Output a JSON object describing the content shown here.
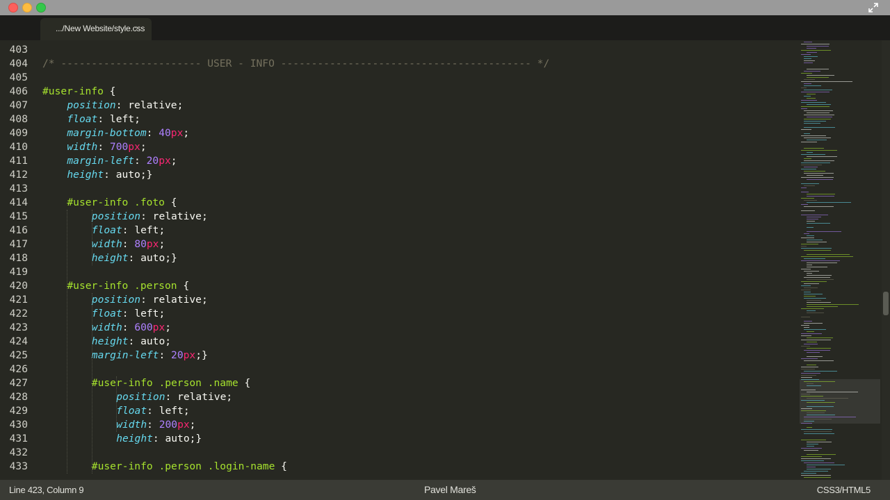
{
  "tab": {
    "label": ".../New Website/style.css",
    "close": "×"
  },
  "status": {
    "position": "Line 423, Column 9",
    "author": "Pavel Mareš",
    "syntax": "CSS3/HTML5"
  },
  "colors": {
    "comment": "#75715e",
    "selector": "#a6e22e",
    "property": "#66d9ef",
    "number": "#ae81ff",
    "unit": "#f92672",
    "text": "#f8f8f2",
    "background": "#272822"
  },
  "icons": {
    "close": "close-icon",
    "fullscreen": "fullscreen-icon"
  },
  "lines": [
    {
      "n": "403",
      "indent": 0,
      "tokens": []
    },
    {
      "n": "404",
      "indent": 0,
      "tokens": [
        [
          "comment",
          "/* ----------------------- USER - INFO ----------------------------------------- */"
        ]
      ]
    },
    {
      "n": "405",
      "indent": 0,
      "tokens": []
    },
    {
      "n": "406",
      "indent": 0,
      "tokens": [
        [
          "sel",
          "#user-info"
        ],
        [
          "punc",
          " {"
        ]
      ]
    },
    {
      "n": "407",
      "indent": 1,
      "tokens": [
        [
          "prop",
          "position"
        ],
        [
          "punc",
          ": "
        ],
        [
          "val",
          "relative"
        ],
        [
          "punc",
          ";"
        ]
      ]
    },
    {
      "n": "408",
      "indent": 1,
      "tokens": [
        [
          "prop",
          "float"
        ],
        [
          "punc",
          ": "
        ],
        [
          "val",
          "left"
        ],
        [
          "punc",
          ";"
        ]
      ]
    },
    {
      "n": "409",
      "indent": 1,
      "tokens": [
        [
          "prop",
          "margin-bottom"
        ],
        [
          "punc",
          ": "
        ],
        [
          "num",
          "40"
        ],
        [
          "unit",
          "px"
        ],
        [
          "punc",
          ";"
        ]
      ]
    },
    {
      "n": "410",
      "indent": 1,
      "tokens": [
        [
          "prop",
          "width"
        ],
        [
          "punc",
          ": "
        ],
        [
          "num",
          "700"
        ],
        [
          "unit",
          "px"
        ],
        [
          "punc",
          ";"
        ]
      ]
    },
    {
      "n": "411",
      "indent": 1,
      "tokens": [
        [
          "prop",
          "margin-left"
        ],
        [
          "punc",
          ": "
        ],
        [
          "num",
          "20"
        ],
        [
          "unit",
          "px"
        ],
        [
          "punc",
          ";"
        ]
      ]
    },
    {
      "n": "412",
      "indent": 1,
      "tokens": [
        [
          "prop",
          "height"
        ],
        [
          "punc",
          ": "
        ],
        [
          "val",
          "auto"
        ],
        [
          "punc",
          ";}"
        ]
      ]
    },
    {
      "n": "413",
      "indent": 0,
      "tokens": []
    },
    {
      "n": "414",
      "indent": 1,
      "tokens": [
        [
          "sel",
          "#user-info .foto"
        ],
        [
          "punc",
          " {"
        ]
      ]
    },
    {
      "n": "415",
      "indent": 2,
      "tokens": [
        [
          "prop",
          "position"
        ],
        [
          "punc",
          ": "
        ],
        [
          "val",
          "relative"
        ],
        [
          "punc",
          ";"
        ]
      ]
    },
    {
      "n": "416",
      "indent": 2,
      "tokens": [
        [
          "prop",
          "float"
        ],
        [
          "punc",
          ": "
        ],
        [
          "val",
          "left"
        ],
        [
          "punc",
          ";"
        ]
      ]
    },
    {
      "n": "417",
      "indent": 2,
      "tokens": [
        [
          "prop",
          "width"
        ],
        [
          "punc",
          ": "
        ],
        [
          "num",
          "80"
        ],
        [
          "unit",
          "px"
        ],
        [
          "punc",
          ";"
        ]
      ]
    },
    {
      "n": "418",
      "indent": 2,
      "tokens": [
        [
          "prop",
          "height"
        ],
        [
          "punc",
          ": "
        ],
        [
          "val",
          "auto"
        ],
        [
          "punc",
          ";}"
        ]
      ]
    },
    {
      "n": "419",
      "indent": 0,
      "tokens": []
    },
    {
      "n": "420",
      "indent": 1,
      "tokens": [
        [
          "sel",
          "#user-info .person"
        ],
        [
          "punc",
          " {"
        ]
      ]
    },
    {
      "n": "421",
      "indent": 2,
      "tokens": [
        [
          "prop",
          "position"
        ],
        [
          "punc",
          ": "
        ],
        [
          "val",
          "relative"
        ],
        [
          "punc",
          ";"
        ]
      ]
    },
    {
      "n": "422",
      "indent": 2,
      "tokens": [
        [
          "prop",
          "float"
        ],
        [
          "punc",
          ": "
        ],
        [
          "val",
          "left"
        ],
        [
          "punc",
          ";"
        ]
      ]
    },
    {
      "n": "423",
      "indent": 2,
      "tokens": [
        [
          "prop",
          "width"
        ],
        [
          "punc",
          ": "
        ],
        [
          "num",
          "600"
        ],
        [
          "unit",
          "px"
        ],
        [
          "punc",
          ";"
        ]
      ]
    },
    {
      "n": "424",
      "indent": 2,
      "tokens": [
        [
          "prop",
          "height"
        ],
        [
          "punc",
          ": "
        ],
        [
          "val",
          "auto"
        ],
        [
          "punc",
          ";"
        ]
      ]
    },
    {
      "n": "425",
      "indent": 2,
      "tokens": [
        [
          "prop",
          "margin-left"
        ],
        [
          "punc",
          ": "
        ],
        [
          "num",
          "20"
        ],
        [
          "unit",
          "px"
        ],
        [
          "punc",
          ";}"
        ]
      ]
    },
    {
      "n": "426",
      "indent": 0,
      "tokens": []
    },
    {
      "n": "427",
      "indent": 2,
      "tokens": [
        [
          "sel",
          "#user-info .person .name"
        ],
        [
          "punc",
          " {"
        ]
      ]
    },
    {
      "n": "428",
      "indent": 3,
      "tokens": [
        [
          "prop",
          "position"
        ],
        [
          "punc",
          ": "
        ],
        [
          "val",
          "relative"
        ],
        [
          "punc",
          ";"
        ]
      ]
    },
    {
      "n": "429",
      "indent": 3,
      "tokens": [
        [
          "prop",
          "float"
        ],
        [
          "punc",
          ": "
        ],
        [
          "val",
          "left"
        ],
        [
          "punc",
          ";"
        ]
      ]
    },
    {
      "n": "430",
      "indent": 3,
      "tokens": [
        [
          "prop",
          "width"
        ],
        [
          "punc",
          ": "
        ],
        [
          "num",
          "200"
        ],
        [
          "unit",
          "px"
        ],
        [
          "punc",
          ";"
        ]
      ]
    },
    {
      "n": "431",
      "indent": 3,
      "tokens": [
        [
          "prop",
          "height"
        ],
        [
          "punc",
          ": "
        ],
        [
          "val",
          "auto"
        ],
        [
          "punc",
          ";}"
        ]
      ]
    },
    {
      "n": "432",
      "indent": 0,
      "tokens": []
    },
    {
      "n": "433",
      "indent": 2,
      "tokens": [
        [
          "sel",
          "#user-info .person .login-name"
        ],
        [
          "punc",
          " {"
        ]
      ]
    }
  ]
}
